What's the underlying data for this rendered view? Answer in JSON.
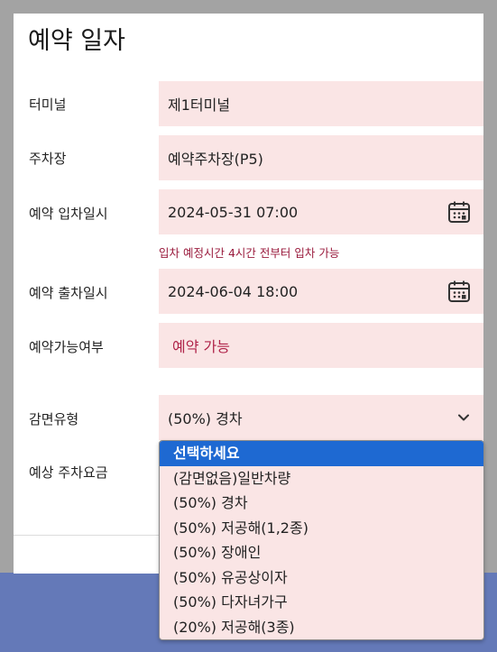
{
  "modal": {
    "title": "예약 일자"
  },
  "form": {
    "terminal": {
      "label": "터미널",
      "value": "제1터미널"
    },
    "parking": {
      "label": "주차장",
      "value": "예약주차장(P5)"
    },
    "entry": {
      "label": "예약 입차일시",
      "value": "2024-05-31 07:00",
      "hint": "입차 예정시간 4시간 전부터 입차 가능"
    },
    "exit": {
      "label": "예약 출차일시",
      "value": "2024-06-04 18:00"
    },
    "availability": {
      "label": "예약가능여부",
      "value": "예약 가능"
    },
    "discount": {
      "label": "감면유형",
      "value": "(50%) 경차"
    },
    "fee": {
      "label": "예상 주차요금"
    }
  },
  "dropdown": {
    "options": [
      "선택하세요",
      "(감면없음)일반차량",
      "(50%) 경차",
      "(50%) 저공해(1,2종)",
      "(50%) 장애인",
      "(50%) 유공상이자",
      "(50%) 다자녀가구",
      "(20%) 저공해(3종)"
    ],
    "highlighted_index": 0
  },
  "colors": {
    "field_bg": "#fae5e5",
    "accent": "#1e69d2",
    "hint": "#9a1b3d",
    "bottom_bar": "#6479b8"
  }
}
